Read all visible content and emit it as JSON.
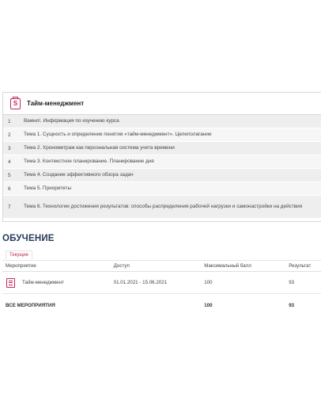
{
  "course": {
    "title": "Тайм-менеджмент",
    "icon": "course-document-icon",
    "topics": [
      {
        "num": "1",
        "text": "Важно!. Информация по изучению курса"
      },
      {
        "num": "2",
        "text": "Тема 1. Сущность и определение понятия «тайм-менеджмент». Целеполагание"
      },
      {
        "num": "3",
        "text": "Тема 2. Хронометраж как персональная система учета времени"
      },
      {
        "num": "4",
        "text": "Тема 3. Контекстное планирование. Планирование дня"
      },
      {
        "num": "5",
        "text": "Тема 4. Создание эффективного обзора задач"
      },
      {
        "num": "6",
        "text": "Тема 5. Приоритеты"
      },
      {
        "num": "7",
        "text": "Тема 6. Технологии достижения результатов: способы распределения рабочей нагрузки и самонастройки на действия"
      }
    ]
  },
  "training": {
    "title": "ОБУЧЕНИЕ",
    "tab": "Текущие",
    "columns": [
      "Мероприятие",
      "Доступ",
      "Максимальный балл",
      "Результат"
    ],
    "rows": [
      {
        "event": "Тайм-менеджмент",
        "access": "01.01.2021 - 15.06.2021",
        "max": "100",
        "result": "93"
      }
    ],
    "total": {
      "label": "ВСЕ МЕРОПРИЯТИЯ",
      "max": "100",
      "result": "93"
    }
  },
  "colors": {
    "accent": "#c0285a",
    "heading": "#2a3a5c",
    "row": "#eeeeee"
  }
}
